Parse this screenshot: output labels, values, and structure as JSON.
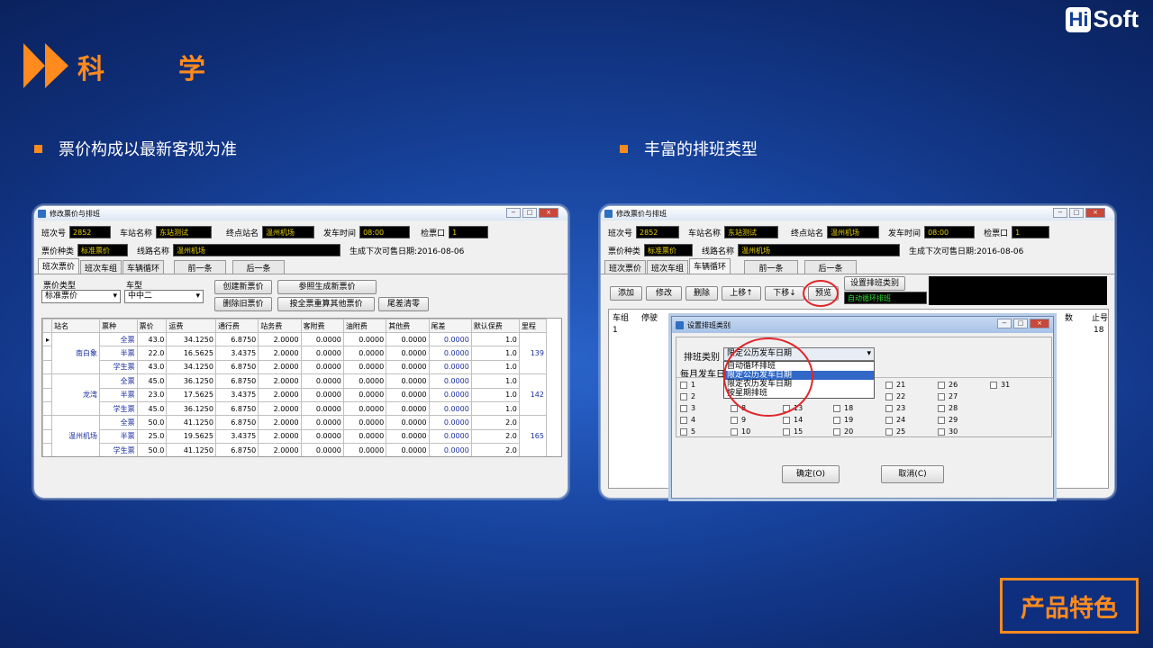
{
  "brand": {
    "logo_hi": "Hi",
    "logo_rest": "Soft"
  },
  "section": {
    "title": "科学",
    "bullet_left": "票价构成以最新客规为准",
    "bullet_right": "丰富的排班类型",
    "feature_badge": "产品特色"
  },
  "win": {
    "title": "修改票价与排班",
    "labels": {
      "bus_no": "班次号",
      "station": "车站名称",
      "terminal": "终点站名",
      "depart": "发车时间",
      "gate": "检票口",
      "fare_type": "票价种类",
      "route": "线路名称",
      "next_sale": "生成下次可售日期:2016-08-06"
    },
    "values": {
      "bus_no": "2852",
      "station": "东站测试",
      "terminal": "温州机场",
      "depart": "08:00",
      "gate": "1",
      "fare_type": "标准票价",
      "route": "温州机场"
    },
    "tabs": [
      "班次票价",
      "班次车组",
      "车辆循环"
    ],
    "prev": "前一条",
    "next": "后一条"
  },
  "left": {
    "fare_type_label": "票价类型",
    "fare_type_value": "标准票价",
    "bus_type_label": "车型",
    "bus_type_value": "中中二",
    "buttons": {
      "create": "创建新票价",
      "ref": "参照生成新票价",
      "del": "删除旧票价",
      "recalc": "按全票重算其他票价",
      "clear": "尾差清零"
    },
    "columns": [
      "站名",
      "票种",
      "票价",
      "运费",
      "通行费",
      "站务费",
      "客附费",
      "油附费",
      "其他费",
      "尾差",
      "默认保费",
      "里程"
    ],
    "groups": [
      {
        "station": "南白象",
        "mileage": "139",
        "rows": [
          [
            "全票",
            "43.0",
            "34.1250",
            "6.8750",
            "2.0000",
            "0.0000",
            "0.0000",
            "0.0000",
            "0.0000",
            "1.0"
          ],
          [
            "半票",
            "22.0",
            "16.5625",
            "3.4375",
            "2.0000",
            "0.0000",
            "0.0000",
            "0.0000",
            "0.0000",
            "1.0"
          ],
          [
            "学生票",
            "43.0",
            "34.1250",
            "6.8750",
            "2.0000",
            "0.0000",
            "0.0000",
            "0.0000",
            "0.0000",
            "1.0"
          ]
        ]
      },
      {
        "station": "龙湾",
        "mileage": "142",
        "rows": [
          [
            "全票",
            "45.0",
            "36.1250",
            "6.8750",
            "2.0000",
            "0.0000",
            "0.0000",
            "0.0000",
            "0.0000",
            "1.0"
          ],
          [
            "半票",
            "23.0",
            "17.5625",
            "3.4375",
            "2.0000",
            "0.0000",
            "0.0000",
            "0.0000",
            "0.0000",
            "1.0"
          ],
          [
            "学生票",
            "45.0",
            "36.1250",
            "6.8750",
            "2.0000",
            "0.0000",
            "0.0000",
            "0.0000",
            "0.0000",
            "1.0"
          ]
        ]
      },
      {
        "station": "温州机场",
        "mileage": "165",
        "rows": [
          [
            "全票",
            "50.0",
            "41.1250",
            "6.8750",
            "2.0000",
            "0.0000",
            "0.0000",
            "0.0000",
            "0.0000",
            "2.0"
          ],
          [
            "半票",
            "25.0",
            "19.5625",
            "3.4375",
            "2.0000",
            "0.0000",
            "0.0000",
            "0.0000",
            "0.0000",
            "2.0"
          ],
          [
            "学生票",
            "50.0",
            "41.1250",
            "6.8750",
            "2.0000",
            "0.0000",
            "0.0000",
            "0.0000",
            "0.0000",
            "2.0"
          ]
        ]
      }
    ]
  },
  "right": {
    "buttons": {
      "add": "添加",
      "edit": "修改",
      "del": "删除",
      "up": "上移↑",
      "down": "下移↓",
      "preview": "预览",
      "set_type": "设置排班类别"
    },
    "current_type": "自动循环排班",
    "grid_cols": [
      "车组",
      "停驶",
      "数",
      "止号"
    ],
    "grid_row": [
      "1",
      "18"
    ],
    "dialog": {
      "title": "设置排班类别",
      "type_label": "排班类别",
      "type_value": "限定公历发车日期",
      "monthly_label": "每月发车日",
      "options": [
        "自动循环排班",
        "限定公历发车日期",
        "限定农历发车日期",
        "按星期排班"
      ],
      "days": [
        "1",
        "2",
        "3",
        "4",
        "5",
        "8",
        "9",
        "10",
        "13",
        "14",
        "15",
        "18",
        "19",
        "20",
        "21",
        "22",
        "23",
        "24",
        "25",
        "26",
        "27",
        "28",
        "29",
        "30",
        "31"
      ],
      "ok": "确定(O)",
      "cancel": "取消(C)"
    }
  },
  "colors": {
    "accent": "#ff8a1e",
    "field_text": "#e8d000",
    "link_blue": "#1a2fa0"
  }
}
